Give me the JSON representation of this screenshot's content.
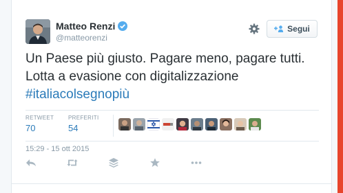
{
  "author": {
    "name": "Matteo Renzi",
    "handle": "@matteorenzi",
    "verified": true
  },
  "follow_button": {
    "label": "Segui"
  },
  "tweet": {
    "text": "Un Paese più giusto. Pagare meno, pagare tutti. Lotta a evasione con digitalizzazione",
    "hashtag": "#italiacolsegnopiù"
  },
  "stats": {
    "retweet_label": "RETWEET",
    "retweet_count": "70",
    "favorites_label": "PREFERITI",
    "favorites_count": "54"
  },
  "timestamp": "15:29 - 15 ott 2015",
  "colors": {
    "link": "#2b7bb9",
    "text": "#292f33",
    "muted": "#8899a6",
    "accent_strip": "#e8452c"
  },
  "icons": [
    "verified-icon",
    "gear-icon",
    "add-user-icon",
    "reply-icon",
    "retweet-icon",
    "buffer-icon",
    "favorite-icon",
    "more-icon"
  ]
}
